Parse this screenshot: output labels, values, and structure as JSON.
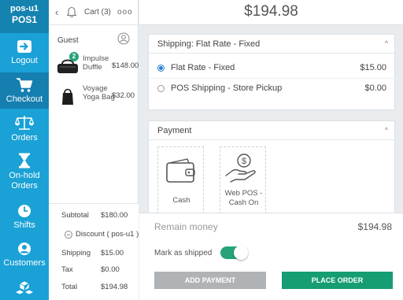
{
  "sidebar": {
    "user": "pos-u1",
    "pos": "POS1",
    "items": [
      {
        "label": "Logout",
        "icon": "logout-icon"
      },
      {
        "label": "Checkout",
        "icon": "cart-icon"
      },
      {
        "label": "Orders",
        "icon": "scale-icon"
      },
      {
        "label": "On-hold Orders",
        "icon": "hourglass-icon"
      },
      {
        "label": "Shifts",
        "icon": "clock-icon"
      },
      {
        "label": "Customers",
        "icon": "user-icon"
      },
      {
        "label": "",
        "icon": "boxes-icon"
      }
    ],
    "active_color": "#157fb0",
    "color": "#1aa1d6"
  },
  "cart": {
    "title": "Cart (3)",
    "more": "ooo",
    "guest": "Guest",
    "items": [
      {
        "name": "Impulse Duffle",
        "price": "$148.00",
        "qty": "2"
      },
      {
        "name": "Voyage Yoga Bag",
        "price": "$32.00",
        "qty": ""
      }
    ],
    "subtotal_label": "Subtotal",
    "subtotal": "$180.00",
    "discount_label": "Discount ( pos-u1 )",
    "shipping_label": "Shipping",
    "shipping": "$15.00",
    "tax_label": "Tax",
    "tax": "$0.00",
    "total_label": "Total",
    "total": "$194.98"
  },
  "checkout": {
    "grand_total": "$194.98",
    "shipping_title": "Shipping: Flat Rate - Fixed",
    "shipping_options": [
      {
        "name": "Flat Rate - Fixed",
        "price": "$15.00",
        "selected": true
      },
      {
        "name": "POS Shipping - Store Pickup",
        "price": "$0.00",
        "selected": false
      }
    ],
    "payment_title": "Payment",
    "payment_options": [
      {
        "label": "Cash",
        "icon": "wallet-icon"
      },
      {
        "label": "Web POS - Cash On",
        "icon": "hand-coin-icon"
      }
    ],
    "remain_label": "Remain money",
    "remain_value": "$194.98",
    "mark_shipped_label": "Mark as shipped",
    "mark_shipped": true,
    "add_payment": "ADD PAYMENT",
    "place_order": "PLACE ORDER",
    "accent_color": "#169d73"
  }
}
